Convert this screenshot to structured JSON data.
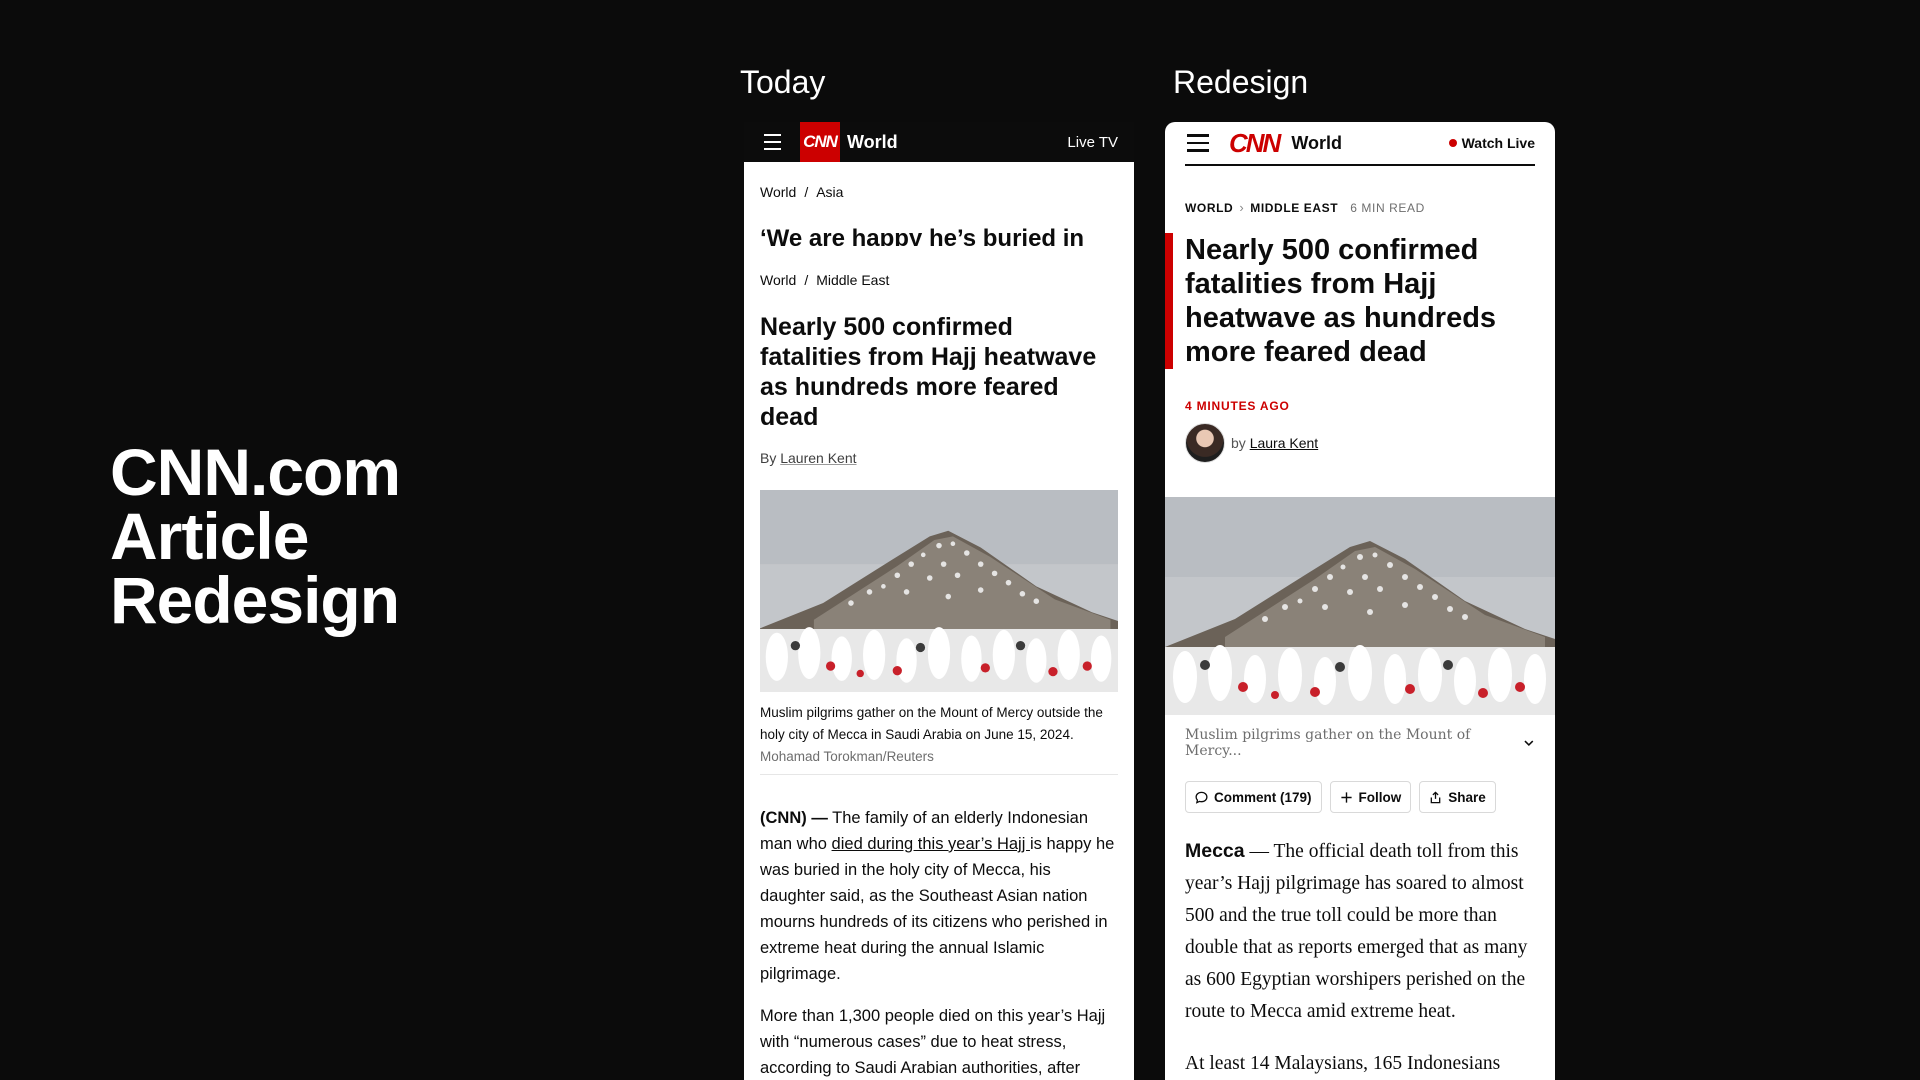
{
  "hero": {
    "line1": "CNN.com",
    "line2": "Article",
    "line3": "Redesign"
  },
  "labels": {
    "today": "Today",
    "redesign": "Redesign"
  },
  "today": {
    "logo": "CNN",
    "section": "World",
    "live_tv": "Live TV",
    "crumb_prev": {
      "a": "World",
      "sep": "/",
      "b": "Asia"
    },
    "prev_headline": "‘We are happy he’s buried in",
    "crumb": {
      "a": "World",
      "sep": "/",
      "b": "Middle East"
    },
    "headline": "Nearly 500 confirmed fatalities from Hajj heatwave as hundreds more feared dead",
    "byline_prefix": "By",
    "author": "Lauren Kent",
    "caption": "Muslim pilgrims gather on the Mount of Mercy outside the holy city of Mecca in Saudi Arabia on June 15, 2024.",
    "credit": "Mohamad Torokman/Reuters",
    "para1_lead": "(CNN) —",
    "para1_a": " The family of an elderly Indonesian man who ",
    "para1_link": "died during this year’s Hajj ",
    "para1_b": "is happy he was buried in the holy city of Mecca, his daughter said, as the Southeast Asian nation mourns hundreds of its citizens who perished in extreme heat during the annual Islamic pilgrimage.",
    "para2": "More than 1,300 people died on this year’s Hajj with “numerous cases” due to heat stress, according to Saudi Arabian authorities, after"
  },
  "redesign": {
    "logo": "CNN",
    "section": "World",
    "watch_live": "Watch Live",
    "crumb_a": "WORLD",
    "crumb_b": "MIDDLE EAST",
    "read_time": "6 MIN READ",
    "headline": "Nearly 500 confirmed fatalities from Hajj heatwave as hundreds more feared dead",
    "time_ago": "4 MINUTES AGO",
    "by": "by",
    "author": "Laura Kent",
    "caption": "Muslim pilgrims gather on the Mount of Mercy...",
    "comment": "Comment (179)",
    "follow": "Follow",
    "share": "Share",
    "para1_lead": "Mecca",
    "para1": " — The official death toll from this year’s Hajj pilgrimage has soared to almost 500 and the true toll could be more than double that as reports emerged that as many as 600 Egyptian worshipers perished on the route to Mecca amid extreme heat.",
    "para2": "At least 14 Malaysians, 165 Indonesians"
  },
  "colors": {
    "cnn_red": "#cc0000",
    "background": "#0b0b0b"
  }
}
